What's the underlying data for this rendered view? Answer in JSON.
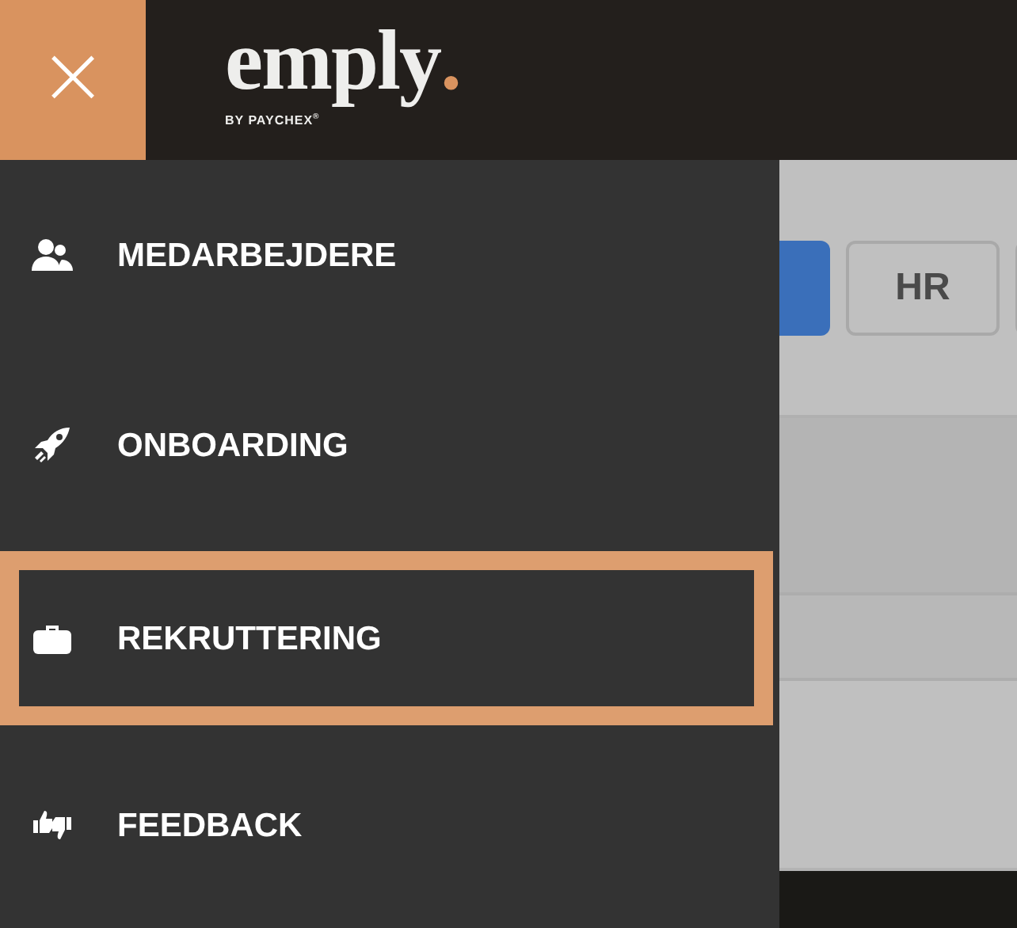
{
  "header": {
    "close_button": {
      "label": "×"
    },
    "logo": {
      "wordmark": "emply",
      "dot": ".",
      "tagline": "BY PAYCHEX$^{®}$"
    }
  },
  "menu": {
    "items": [
      {
        "label": "MEDARBEJDERE",
        "selected": false
      },
      {
        "label": "ONBOARDING",
        "selected": false
      },
      {
        "label": "REKRUTTERING",
        "selected": true
      },
      {
        "label": "FEEDBACK",
        "selected": false
      }
    ]
  },
  "background_page": {
    "buttons": [
      {
        "kind": "filled"
      },
      {
        "kind": "outline",
        "label": "HR"
      },
      {
        "kind": "outline"
      }
    ]
  }
}
